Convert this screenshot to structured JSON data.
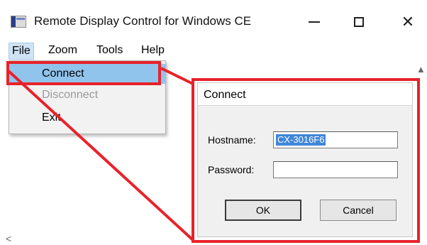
{
  "window": {
    "title": "Remote Display Control for Windows CE",
    "icon": "app-window-icon"
  },
  "window_controls": {
    "minimize": "minimize-icon",
    "maximize": "maximize-icon",
    "close": "close-icon"
  },
  "menubar": {
    "items": [
      {
        "label": "File",
        "active": true
      },
      {
        "label": "Zoom"
      },
      {
        "label": "Tools"
      },
      {
        "label": "Help"
      }
    ]
  },
  "file_menu": {
    "items": [
      {
        "label": "Connect",
        "highlighted": true
      },
      {
        "label": "Disconnect",
        "disabled": true
      },
      {
        "label": "Exit"
      }
    ]
  },
  "connect_dialog": {
    "title": "Connect",
    "hostname_label": "Hostname:",
    "hostname_value": "CX-3016F6",
    "password_label": "Password:",
    "password_value": "",
    "ok_label": "OK",
    "cancel_label": "Cancel"
  },
  "scroll": {
    "up": "▲",
    "left": "<",
    "right": ">"
  },
  "colors": {
    "callout": "#e8222b",
    "menu_highlight": "#91c4ec",
    "selection": "#3f86d9"
  }
}
